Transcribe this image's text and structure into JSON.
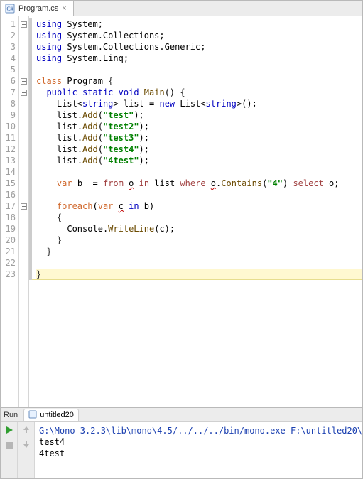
{
  "tab": {
    "filename": "Program.cs"
  },
  "code": {
    "lines": [
      {
        "n": 1,
        "fold": "minus",
        "ind": 0,
        "tokens": [
          [
            "kw",
            "using"
          ],
          [
            "sp",
            " "
          ],
          [
            "ident",
            "System"
          ],
          [
            "op",
            ";"
          ]
        ]
      },
      {
        "n": 2,
        "fold": "",
        "ind": 0,
        "tokens": [
          [
            "kw",
            "using"
          ],
          [
            "sp",
            " "
          ],
          [
            "ident",
            "System.Collections"
          ],
          [
            "op",
            ";"
          ]
        ]
      },
      {
        "n": 3,
        "fold": "",
        "ind": 0,
        "tokens": [
          [
            "kw",
            "using"
          ],
          [
            "sp",
            " "
          ],
          [
            "ident",
            "System.Collections.Generic"
          ],
          [
            "op",
            ";"
          ]
        ]
      },
      {
        "n": 4,
        "fold": "up",
        "ind": 0,
        "tokens": [
          [
            "kw",
            "using"
          ],
          [
            "sp",
            " "
          ],
          [
            "ident",
            "System.Linq"
          ],
          [
            "op",
            ";"
          ]
        ]
      },
      {
        "n": 5,
        "fold": "",
        "ind": 0,
        "tokens": []
      },
      {
        "n": 6,
        "fold": "minus",
        "ind": 0,
        "tokens": [
          [
            "kw-orange",
            "class"
          ],
          [
            "sp",
            " "
          ],
          [
            "ident",
            "Program"
          ],
          [
            "sp",
            " "
          ],
          [
            "brace",
            "{"
          ]
        ]
      },
      {
        "n": 7,
        "fold": "minus",
        "ind": 1,
        "tokens": [
          [
            "kw",
            "public"
          ],
          [
            "sp",
            " "
          ],
          [
            "kw",
            "static"
          ],
          [
            "sp",
            " "
          ],
          [
            "kw",
            "void"
          ],
          [
            "sp",
            " "
          ],
          [
            "meth",
            "Main"
          ],
          [
            "op",
            "()"
          ],
          [
            "sp",
            " "
          ],
          [
            "brace",
            "{"
          ]
        ]
      },
      {
        "n": 8,
        "fold": "",
        "ind": 2,
        "tokens": [
          [
            "ident",
            "List"
          ],
          [
            "op",
            "<"
          ],
          [
            "kw",
            "string"
          ],
          [
            "op",
            ">"
          ],
          [
            "sp",
            " "
          ],
          [
            "ident",
            "list"
          ],
          [
            "sp",
            " "
          ],
          [
            "op",
            "="
          ],
          [
            "sp",
            " "
          ],
          [
            "newkw",
            "new"
          ],
          [
            "sp",
            " "
          ],
          [
            "ident",
            "List"
          ],
          [
            "op",
            "<"
          ],
          [
            "kw",
            "string"
          ],
          [
            "op",
            ">"
          ],
          [
            "op",
            "();"
          ]
        ]
      },
      {
        "n": 9,
        "fold": "",
        "ind": 2,
        "tokens": [
          [
            "ident",
            "list"
          ],
          [
            "op",
            "."
          ],
          [
            "meth",
            "Add"
          ],
          [
            "op",
            "("
          ],
          [
            "str",
            "\"test\""
          ],
          [
            "op",
            ");"
          ]
        ]
      },
      {
        "n": 10,
        "fold": "",
        "ind": 2,
        "tokens": [
          [
            "ident",
            "list"
          ],
          [
            "op",
            "."
          ],
          [
            "meth",
            "Add"
          ],
          [
            "op",
            "("
          ],
          [
            "str",
            "\"test2\""
          ],
          [
            "op",
            ");"
          ]
        ]
      },
      {
        "n": 11,
        "fold": "",
        "ind": 2,
        "tokens": [
          [
            "ident",
            "list"
          ],
          [
            "op",
            "."
          ],
          [
            "meth",
            "Add"
          ],
          [
            "op",
            "("
          ],
          [
            "str",
            "\"test3\""
          ],
          [
            "op",
            ");"
          ]
        ]
      },
      {
        "n": 12,
        "fold": "",
        "ind": 2,
        "tokens": [
          [
            "ident",
            "list"
          ],
          [
            "op",
            "."
          ],
          [
            "meth",
            "Add"
          ],
          [
            "op",
            "("
          ],
          [
            "str",
            "\"test4\""
          ],
          [
            "op",
            ");"
          ]
        ]
      },
      {
        "n": 13,
        "fold": "",
        "ind": 2,
        "tokens": [
          [
            "ident",
            "list"
          ],
          [
            "op",
            "."
          ],
          [
            "meth",
            "Add"
          ],
          [
            "op",
            "("
          ],
          [
            "str",
            "\"4test\""
          ],
          [
            "op",
            ");"
          ]
        ]
      },
      {
        "n": 14,
        "fold": "",
        "ind": 2,
        "tokens": []
      },
      {
        "n": 15,
        "fold": "",
        "ind": 2,
        "tokens": [
          [
            "kw-orange",
            "var"
          ],
          [
            "sp",
            " "
          ],
          [
            "ident",
            "b"
          ],
          [
            "sp",
            "  "
          ],
          [
            "op",
            "="
          ],
          [
            "sp",
            " "
          ],
          [
            "linq",
            "from"
          ],
          [
            "sp",
            " "
          ],
          [
            "squig",
            "o"
          ],
          [
            "sp",
            " "
          ],
          [
            "linq",
            "in"
          ],
          [
            "sp",
            " "
          ],
          [
            "ident",
            "list"
          ],
          [
            "sp",
            " "
          ],
          [
            "linq",
            "where"
          ],
          [
            "sp",
            " "
          ],
          [
            "squig",
            "o"
          ],
          [
            "op",
            "."
          ],
          [
            "meth",
            "Contains"
          ],
          [
            "op",
            "("
          ],
          [
            "str",
            "\"4\""
          ],
          [
            "op",
            ")"
          ],
          [
            "sp",
            " "
          ],
          [
            "linq",
            "select"
          ],
          [
            "sp",
            " "
          ],
          [
            "ident",
            "o"
          ],
          [
            "op",
            ";"
          ]
        ]
      },
      {
        "n": 16,
        "fold": "",
        "ind": 2,
        "tokens": []
      },
      {
        "n": 17,
        "fold": "minus",
        "ind": 2,
        "tokens": [
          [
            "kw-orange",
            "foreach"
          ],
          [
            "op",
            "("
          ],
          [
            "kw-orange",
            "var"
          ],
          [
            "sp",
            " "
          ],
          [
            "squig",
            "c"
          ],
          [
            "sp",
            " "
          ],
          [
            "kw",
            "in"
          ],
          [
            "sp",
            " "
          ],
          [
            "ident",
            "b"
          ],
          [
            "op",
            ")"
          ]
        ]
      },
      {
        "n": 18,
        "fold": "",
        "ind": 2,
        "tokens": [
          [
            "brace",
            "{"
          ]
        ]
      },
      {
        "n": 19,
        "fold": "",
        "ind": 3,
        "tokens": [
          [
            "ident",
            "Console"
          ],
          [
            "op",
            "."
          ],
          [
            "meth",
            "WriteLine"
          ],
          [
            "op",
            "("
          ],
          [
            "ident",
            "c"
          ],
          [
            "op",
            ");"
          ]
        ]
      },
      {
        "n": 20,
        "fold": "",
        "ind": 2,
        "tokens": [
          [
            "brace",
            "}"
          ]
        ]
      },
      {
        "n": 21,
        "fold": "up",
        "ind": 1,
        "tokens": [
          [
            "brace",
            "}"
          ]
        ]
      },
      {
        "n": 22,
        "fold": "",
        "ind": 0,
        "tokens": []
      },
      {
        "n": 23,
        "fold": "up",
        "ind": 0,
        "hl": true,
        "tokens": [
          [
            "brace",
            "}"
          ]
        ]
      }
    ]
  },
  "run": {
    "tab_label": "Run",
    "config_name": "untitled20",
    "command": "G:\\Mono-3.2.3\\lib\\mono\\4.5/../../../bin/mono.exe F:\\untitled20\\",
    "output": [
      "test4",
      "4test"
    ]
  }
}
